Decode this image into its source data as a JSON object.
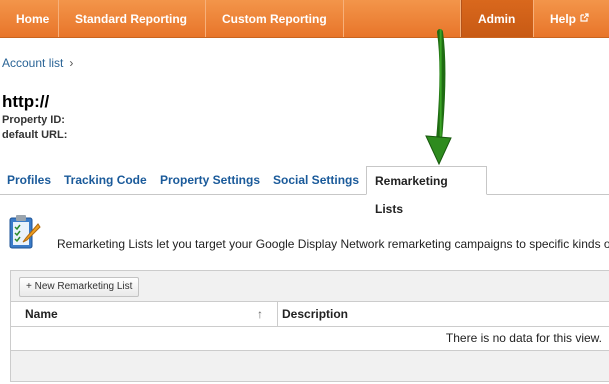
{
  "nav": {
    "home": "Home",
    "standard_reporting": "Standard Reporting",
    "custom_reporting": "Custom Reporting",
    "admin": "Admin",
    "help": "Help",
    "help_icon": "external-link-icon"
  },
  "breadcrumb": {
    "account_list": "Account list",
    "chevron": "›"
  },
  "property": {
    "title": "http://",
    "id_label": "Property ID:",
    "url_label": "default URL:"
  },
  "tabs": [
    {
      "label": "Profiles"
    },
    {
      "label": "Tracking Code"
    },
    {
      "label": "Property Settings"
    },
    {
      "label": "Social Settings"
    },
    {
      "label": "Remarketing Lists"
    }
  ],
  "info": {
    "icon": "clipboard-pencil-icon",
    "text": "Remarketing Lists let you target your Google Display Network remarketing campaigns to specific kinds of users."
  },
  "table": {
    "new_button": "+ New Remarketing List",
    "columns": [
      "Name",
      "Description"
    ],
    "sort_indicator": "↑",
    "empty_message": "There is no data for this view."
  },
  "annotation": {
    "arrow_color": "#2e8b1e"
  },
  "colors": {
    "nav_orange": "#e8752a",
    "nav_active": "#c85a14",
    "link_blue": "#1a5a9a"
  }
}
